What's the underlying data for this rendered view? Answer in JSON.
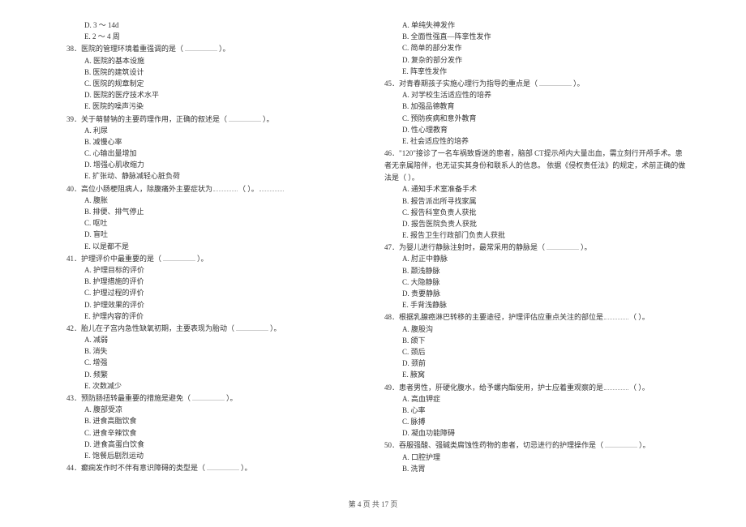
{
  "left_column": {
    "pre_options": [
      "D. 3 ～ 14d",
      "E. 2 ～ 4 周"
    ],
    "questions": [
      {
        "num": "38．",
        "stem_pre": "医院的管理环境着重强调的是（",
        "stem_post": "）。",
        "options": [
          "A. 医院的基本设施",
          "B. 医院的建筑设计",
          "C. 医院的规章制定",
          "D. 医院的医疗技术水平",
          "E. 医院的噪声污染"
        ]
      },
      {
        "num": "39．",
        "stem_pre": "关于萌替钠的主要药理作用，正确的叙述是（",
        "stem_post": "）。",
        "options": [
          "A. 利尿",
          "B. 减慢心率",
          "C. 心输出量增加",
          "D. 增强心肌收缩力",
          "E. 扩张动、静脉减轻心脏负荷"
        ]
      },
      {
        "num": "40．",
        "stem_pre": "高位小肠梗阻病人，除腹痛外主要症状为",
        "stem_post": "（       ）。",
        "options": [
          "A. 腹胀",
          "B. 排便、排气停止",
          "C. 呕吐",
          "D. 盲吐",
          "E. 以是都不是"
        ]
      },
      {
        "num": "41．",
        "stem_pre": "护理评价中最重要的是（",
        "stem_post": "）。",
        "options": [
          "A.  护理目标的评价",
          "B.  护理措施的评价",
          "C.  护理过程的评价",
          "D.  护理效果的评价",
          "E.  护理内容的评价"
        ]
      },
      {
        "num": "42．",
        "stem_pre": "胎儿在子宫内急性缺氧初期，主要表现为胎动（",
        "stem_post": "）。",
        "options": [
          "A. 减弱",
          "B. 消失",
          "C. 增强",
          "D. 频繁",
          "E. 次数减少"
        ]
      },
      {
        "num": "43．",
        "stem_pre": "预防肠扭转最重要的措施是避免（",
        "stem_post": "）。",
        "options": [
          "A. 腹部受凉",
          "B. 进食高脂饮食",
          "C. 进食辛辣饮食",
          "D. 进食高蛋白饮食",
          "E. 饱餐后剧烈运动"
        ]
      },
      {
        "num": "44．",
        "stem_pre": "癫痫发作时不伴有意识障碍的类型是（",
        "stem_post": "）。",
        "options": []
      }
    ]
  },
  "right_column": {
    "pre_options": [
      "A. 单纯失神发作",
      "B. 全面性强直—阵挛性发作",
      "C. 简单的部分发作",
      "D. 复杂的部分发作",
      "E. 阵挛性发作"
    ],
    "questions": [
      {
        "num": "45．",
        "stem_pre": "对青春期孩子实施心理行为指导的重点是（",
        "stem_post": "）。",
        "options": [
          "A.  对学校生活适应性的培养",
          "B.  加强品德教育",
          "C.  预防疾病和意外教育",
          "D.  性心理教育",
          "E.  社会适应性的培养"
        ]
      },
      {
        "num": "46．",
        "stem_multiline": [
          "\"120\"接诊了一名车祸致昏迷的患者，脑部      CT提示颅内大量出血，需立刻行开颅手术。患",
          "者无亲属陪伴，也无证实其身份和联系人的信息。 依据《侵权责任法》的规定，术前正确的做",
          "法是（         ）。"
        ],
        "options": [
          "A.  通知手术室准备手术",
          "B.  报告派出所寻找家属",
          "C.  报告科室负责人获批",
          "D.  报告医院负责人获批",
          "E.  报告卫生行政部门负责人获批"
        ]
      },
      {
        "num": "47．",
        "stem_pre": "为婴儿进行静脉注射时，最常采用的静脉是（",
        "stem_post": "）。",
        "options": [
          "A.  肘正中静脉",
          "B.  颞浅静脉",
          "C.  大隐静脉",
          "D.  贵要静脉",
          "E.  手背浅静脉"
        ]
      },
      {
        "num": "48．",
        "stem_pre": "根据乳腺癌淋巴转移的主要途径，护理评估应重点关注的部位是",
        "stem_post": "（         ）。",
        "options": [
          "A. 腹股沟",
          "B. 颌下",
          "C. 颈后",
          "D. 颈前",
          "E. 腋窝"
        ]
      },
      {
        "num": "49．",
        "stem_pre": "患者男性，肝硬化腹水，给予螺内酯使用，护士应着重观察的是",
        "stem_post": "（         ）。",
        "options": [
          "A. 高血钾症",
          "B. 心率",
          "C. 脉搏",
          "D. 凝血功能障碍"
        ]
      },
      {
        "num": "50．",
        "stem_pre": "吞服强酸、强碱类腐蚀性药物的患者，切忌进行的护理操作是（",
        "stem_post": "）。",
        "options": [
          "A.  口腔护理",
          "B.  洗胃"
        ]
      }
    ]
  },
  "footer": {
    "prefix": "第 ",
    "page_num": "4",
    "mid": " 页 共 ",
    "total": "17",
    "suffix": " 页"
  }
}
